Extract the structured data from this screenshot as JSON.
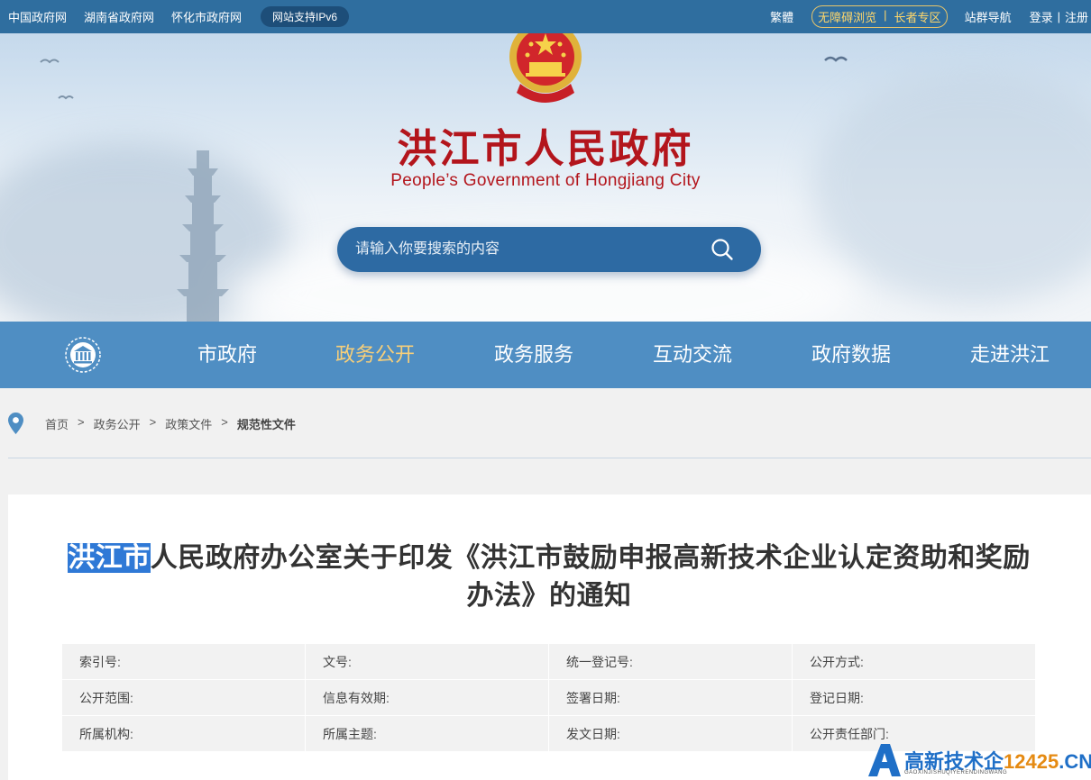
{
  "topbar": {
    "left_links": [
      "中国政府网",
      "湖南省政府网",
      "怀化市政府网"
    ],
    "ipv6_badge": "网站支持IPv6",
    "traditional": "繁體",
    "accessibility": "无障碍浏览",
    "elderly": "长者专区",
    "site_nav": "站群导航",
    "login": "登录",
    "pipe": "|",
    "register": "注册"
  },
  "banner": {
    "title": "洪江市人民政府",
    "subtitle": "People’s Government of Hongjiang City"
  },
  "search": {
    "placeholder": "请输入你要搜索的内容",
    "icon": "search-icon"
  },
  "nav": {
    "home_icon": "government-building-icon",
    "items": [
      {
        "label": "市政府",
        "active": false
      },
      {
        "label": "政务公开",
        "active": true
      },
      {
        "label": "政务服务",
        "active": false
      },
      {
        "label": "互动交流",
        "active": false
      },
      {
        "label": "政府数据",
        "active": false
      },
      {
        "label": "走进洪江",
        "active": false
      }
    ],
    "active_color": "#f7cf7a"
  },
  "breadcrumb": {
    "icon": "location-pin-icon",
    "items": [
      "首页",
      "政务公开",
      "政策文件",
      "规范性文件"
    ],
    "separator": ">"
  },
  "document": {
    "title_highlight": "洪江市",
    "title_rest": "人民政府办公室关于印发《洪江市鼓励申报高新技术企业认定资助和奖励办法》的通知",
    "meta": [
      [
        "索引号:",
        "文号:",
        "统一登记号:",
        "公开方式:"
      ],
      [
        "公开范围:",
        "信息有效期:",
        "签署日期:",
        "登记日期:"
      ],
      [
        "所属机构:",
        "所属主题:",
        "发文日期:",
        "公开责任部门:"
      ]
    ]
  },
  "watermark": {
    "text": "高新技术企",
    "number": "12425",
    "suffix": ".CN",
    "pinyin": "GAOXINJISHUQIYERENDINGWANG"
  },
  "colors": {
    "topbar": "#2f6e9f",
    "nav": "#4f8ec3",
    "title_red": "#b3151c",
    "search": "#2d6aa3"
  }
}
